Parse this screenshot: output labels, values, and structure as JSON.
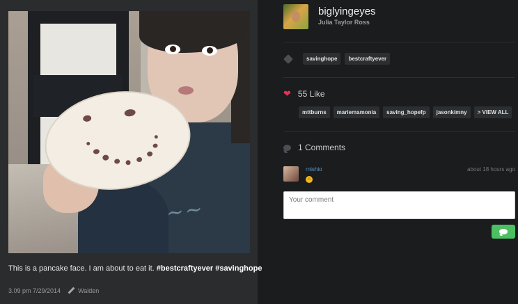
{
  "post": {
    "caption_text": "This is a pancake face. I am about to eat it.",
    "caption_tags": [
      "#bestcraftyever",
      "#savinghope"
    ],
    "timestamp": "3.09 pm 7/29/2014",
    "filter": "Walden"
  },
  "profile": {
    "username": "biglyingeyes",
    "full_name": "Julia Taylor Ross"
  },
  "tags": [
    "savinghope",
    "bestcraftyever"
  ],
  "likes": {
    "label": "55 Like",
    "users": [
      "mttburns",
      "mariemamonia",
      "saving_hopefp",
      "jasonkimny",
      "> VIEW ALL"
    ]
  },
  "comments": {
    "label": "1 Comments",
    "items": [
      {
        "user": "rnishio",
        "time": "about 18 hours ago",
        "emoji": "😊"
      }
    ],
    "input_placeholder": "Your comment"
  },
  "colors": {
    "background": "#1a1c1e",
    "panel": "#2a2c2e",
    "heart": "#e5325b",
    "link": "#5a9bd0",
    "send_button": "#4cbf63"
  },
  "icons": {
    "tag": "tag-icon",
    "like": "heart-icon",
    "comments": "comment-bubble-icon",
    "filter": "pencil-icon",
    "send": "send-comment-icon"
  }
}
